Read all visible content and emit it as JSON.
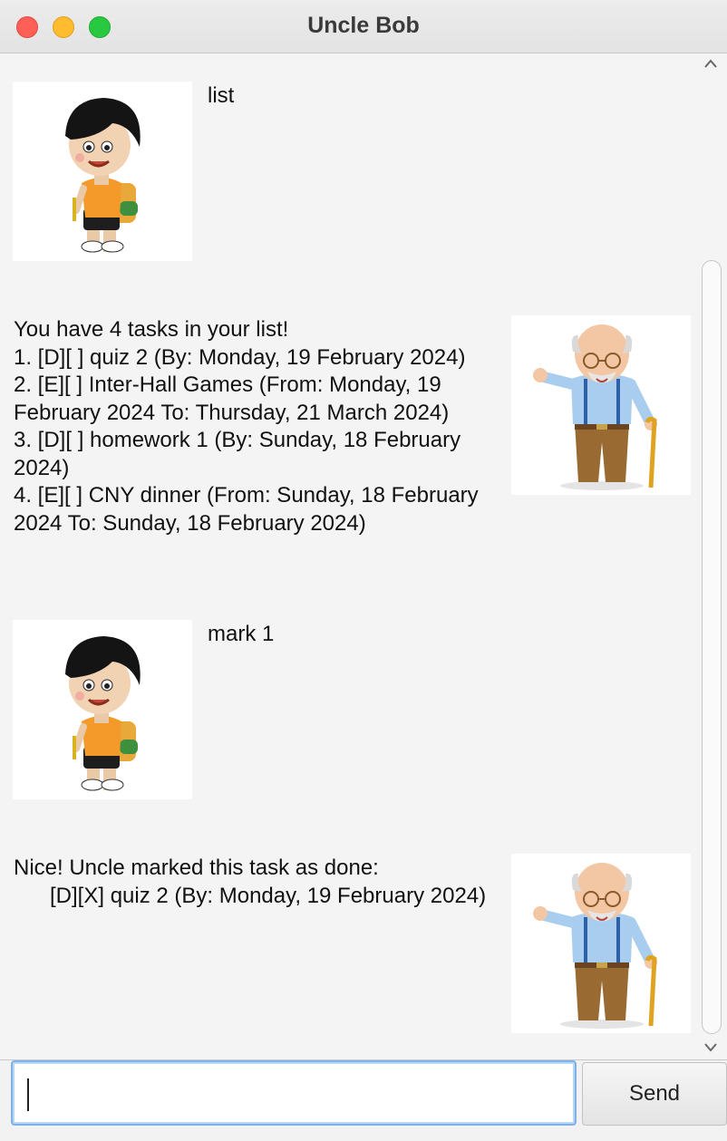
{
  "window": {
    "title": "Uncle Bob"
  },
  "messages": [
    {
      "sender": "user",
      "avatar": "boy-with-backpack-icon",
      "text": "list"
    },
    {
      "sender": "bot",
      "avatar": "grandpa-with-cane-icon",
      "text": "You have 4 tasks in your list!\n1. [D][ ] quiz 2 (By: Monday, 19 February 2024)\n2. [E][ ] Inter-Hall Games (From: Monday, 19\nFebruary 2024 To: Thursday, 21 March 2024)\n3. [D][ ] homework 1 (By: Sunday, 18 February\n2024)\n4. [E][ ] CNY dinner (From: Sunday, 18 February\n2024 To: Sunday, 18 February 2024)"
    },
    {
      "sender": "user",
      "avatar": "boy-with-backpack-icon",
      "text": "mark 1"
    },
    {
      "sender": "bot",
      "avatar": "grandpa-with-cane-icon",
      "text": "Nice! Uncle marked this task as done:\n      [D][X] quiz 2 (By: Monday, 19 February 2024)"
    }
  ],
  "input": {
    "value": "",
    "placeholder": ""
  },
  "send_button": {
    "label": "Send"
  },
  "colors": {
    "focus_border": "#7db2e6",
    "traffic_red": "#fe5f57",
    "traffic_yellow": "#febc2e",
    "traffic_green": "#28c840"
  }
}
